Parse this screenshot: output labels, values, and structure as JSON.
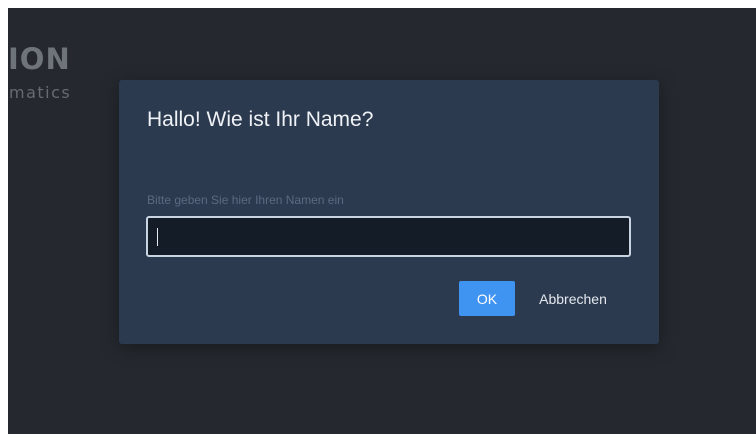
{
  "background": {
    "brand_word": "ION",
    "brand_sub": "matics"
  },
  "dialog": {
    "title": "Hallo! Wie ist Ihr Name?",
    "field_label": "Bitte geben Sie hier Ihren Namen ein",
    "input_value": "",
    "ok_label": "OK",
    "cancel_label": "Abbrechen"
  },
  "colors": {
    "backdrop": "#25292f",
    "dialog_bg": "#2c3a4f",
    "input_bg": "#141c28",
    "input_border": "#c9d4e3",
    "primary_button": "#3f93f1"
  }
}
